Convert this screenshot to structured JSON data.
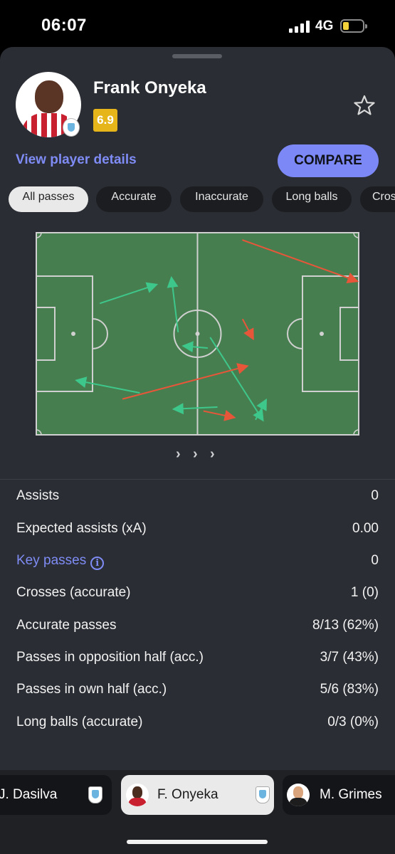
{
  "status_bar": {
    "time": "06:07",
    "network": "4G"
  },
  "player": {
    "name": "Frank Onyeka",
    "rating": "6.9",
    "rating_color": "#e5b51a",
    "view_details_label": "View player details",
    "compare_label": "COMPARE"
  },
  "filters": [
    {
      "label": "All passes",
      "active": true
    },
    {
      "label": "Accurate",
      "active": false
    },
    {
      "label": "Inaccurate",
      "active": false
    },
    {
      "label": "Long balls",
      "active": false
    },
    {
      "label": "Cros",
      "active": false
    }
  ],
  "pass_map": {
    "accurate_color": "#3ec78b",
    "inaccurate_color": "#e8563a",
    "pitch_color": "#477e4f",
    "passes": [
      {
        "from": [
          0.56,
          0.86
        ],
        "to": [
          0.43,
          0.87
        ],
        "accurate": true
      },
      {
        "from": [
          0.2,
          0.35
        ],
        "to": [
          0.37,
          0.26
        ],
        "accurate": true
      },
      {
        "from": [
          0.44,
          0.49
        ],
        "to": [
          0.42,
          0.23
        ],
        "accurate": true
      },
      {
        "from": [
          0.32,
          0.79
        ],
        "to": [
          0.13,
          0.73
        ],
        "accurate": true
      },
      {
        "from": [
          0.53,
          0.57
        ],
        "to": [
          0.46,
          0.56
        ],
        "accurate": true
      },
      {
        "from": [
          0.54,
          0.52
        ],
        "to": [
          0.7,
          0.92
        ],
        "accurate": true
      },
      {
        "from": [
          0.68,
          0.92
        ],
        "to": [
          0.71,
          0.83
        ],
        "accurate": true
      },
      {
        "from": [
          0.64,
          0.04
        ],
        "to": [
          0.99,
          0.24
        ],
        "accurate": false
      },
      {
        "from": [
          0.64,
          0.43
        ],
        "to": [
          0.67,
          0.52
        ],
        "accurate": false
      },
      {
        "from": [
          0.27,
          0.82
        ],
        "to": [
          0.65,
          0.66
        ],
        "accurate": false
      },
      {
        "from": [
          0.52,
          0.88
        ],
        "to": [
          0.61,
          0.91
        ],
        "accurate": false
      }
    ]
  },
  "stats": [
    {
      "label": "Assists",
      "value": "0",
      "link": false
    },
    {
      "label": "Expected assists (xA)",
      "value": "0.00",
      "link": false
    },
    {
      "label": "Key passes",
      "value": "0",
      "link": true
    },
    {
      "label": "Crosses (accurate)",
      "value": "1 (0)",
      "link": false
    },
    {
      "label": "Accurate passes",
      "value": "8/13 (62%)",
      "link": false
    },
    {
      "label": "Passes in opposition half (acc.)",
      "value": "3/7 (43%)",
      "link": false
    },
    {
      "label": "Passes in own half (acc.)",
      "value": "5/6 (83%)",
      "link": false
    },
    {
      "label": "Long balls (accurate)",
      "value": "0/3 (0%)",
      "link": false
    }
  ],
  "switcher": [
    {
      "name": "J. Dasilva",
      "active": false
    },
    {
      "name": "F. Onyeka",
      "active": true
    },
    {
      "name": "M. Grimes",
      "active": false
    }
  ]
}
